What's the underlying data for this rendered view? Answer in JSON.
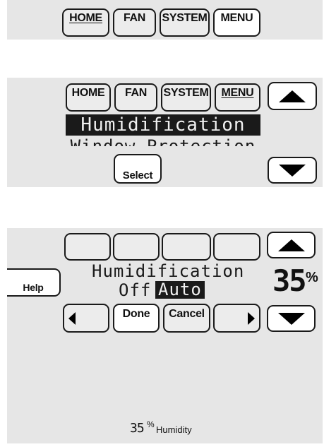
{
  "screen1": {
    "buttons": [
      "HOME",
      "FAN",
      "SYSTEM",
      "MENU"
    ]
  },
  "screen2": {
    "buttons": [
      "HOME",
      "FAN",
      "SYSTEM",
      "MENU"
    ],
    "menu_items": [
      "Humidification",
      "Window Protection"
    ],
    "select_label": "Select",
    "up_icon": "up-arrow-icon",
    "down_icon": "down-arrow-icon"
  },
  "screen3": {
    "help_label": "Help",
    "title": "Humidification",
    "option_off": "Off",
    "option_auto": "Auto",
    "setpoint_value": "35",
    "setpoint_unit": "%",
    "done_label": "Done",
    "cancel_label": "Cancel",
    "status_value": "35",
    "status_unit": "%",
    "status_label": "Humidity"
  }
}
